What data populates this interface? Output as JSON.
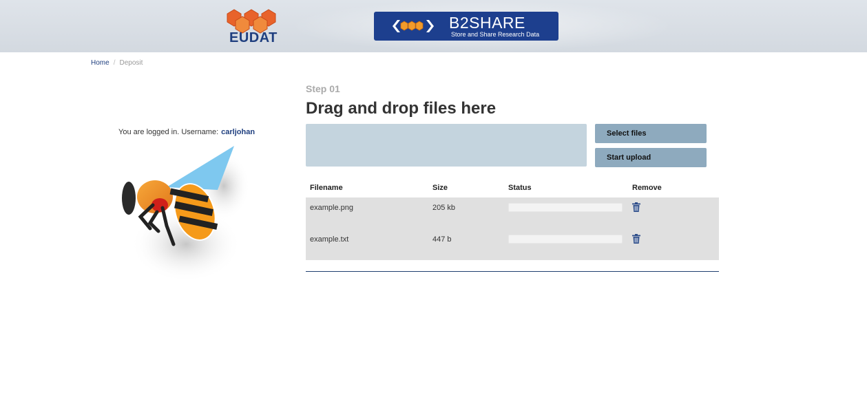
{
  "header": {
    "eudat_text": "EUDAT",
    "b2share_title": "B2SHARE",
    "b2share_subtitle": "Store and Share Research Data",
    "brand_color": "#1d3f8e"
  },
  "breadcrumb": {
    "home": "Home",
    "current": "Deposit",
    "separator": "/"
  },
  "login": {
    "text": "You are logged in. Username:",
    "username": "carljohan"
  },
  "upload": {
    "step": "Step 01",
    "title": "Drag and drop files here",
    "select_label": "Select files",
    "start_label": "Start upload"
  },
  "table": {
    "headers": {
      "filename": "Filename",
      "size": "Size",
      "status": "Status",
      "remove": "Remove"
    },
    "rows": [
      {
        "filename": "example.png",
        "size": "205 kb",
        "progress": 0,
        "remove_icon": "trash-icon"
      },
      {
        "filename": "example.txt",
        "size": "447 b",
        "progress": 0,
        "remove_icon": "trash-icon"
      }
    ]
  }
}
